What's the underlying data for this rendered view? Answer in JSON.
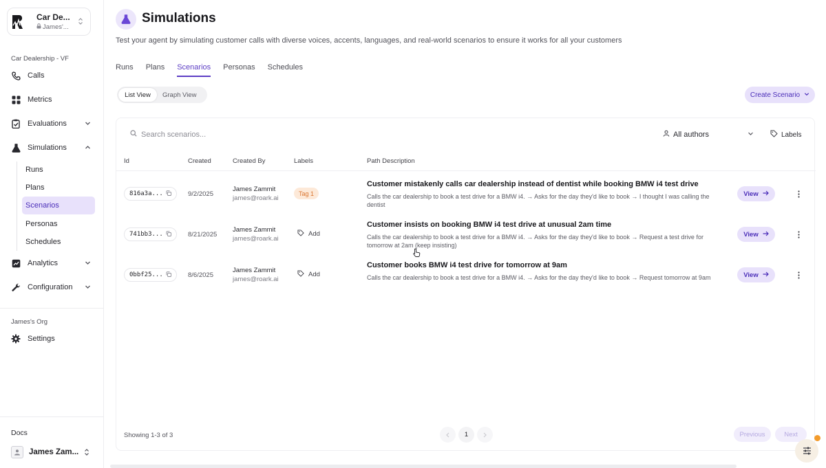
{
  "workspace": {
    "name": "Car De...",
    "owner": "James'..."
  },
  "sidebar": {
    "project_label": "Car Dealership - VF",
    "items": [
      {
        "label": "Calls",
        "icon": "phone-icon"
      },
      {
        "label": "Metrics",
        "icon": "grid-icon"
      },
      {
        "label": "Evaluations",
        "icon": "clipboard-check-icon"
      },
      {
        "label": "Simulations",
        "icon": "flask-icon"
      },
      {
        "label": "Analytics",
        "icon": "chart-icon"
      },
      {
        "label": "Configuration",
        "icon": "wrench-icon"
      }
    ],
    "sub_items": [
      {
        "label": "Runs"
      },
      {
        "label": "Plans"
      },
      {
        "label": "Scenarios"
      },
      {
        "label": "Personas"
      },
      {
        "label": "Schedules"
      }
    ],
    "org_label": "James's Org",
    "settings_label": "Settings",
    "docs_label": "Docs",
    "user_name": "James Zam..."
  },
  "header": {
    "title": "Simulations",
    "description": "Test your agent by simulating customer calls with diverse voices, accents, languages, and real-world scenarios to ensure it works for all your customers"
  },
  "tabs": [
    {
      "label": "Runs"
    },
    {
      "label": "Plans"
    },
    {
      "label": "Scenarios"
    },
    {
      "label": "Personas"
    },
    {
      "label": "Schedules"
    }
  ],
  "view_toggle": {
    "list": "List View",
    "graph": "Graph View"
  },
  "create_button": "Create Scenario",
  "search": {
    "placeholder": "Search scenarios..."
  },
  "authors_filter": "All authors",
  "labels_button": "Labels",
  "table": {
    "headers": {
      "id": "Id",
      "created": "Created",
      "created_by": "Created By",
      "labels": "Labels",
      "path": "Path Description"
    },
    "rows": [
      {
        "id": "816a3a...",
        "created": "9/2/2025",
        "by_name": "James Zammit",
        "by_email": "james@roark.ai",
        "label": "Tag 1",
        "path_title": "Customer mistakenly calls car dealership instead of dentist while booking BMW i4 test drive",
        "path_desc": "Calls the car dealership to book a test drive for a BMW i4. → Asks for the day they'd like to book → I thought I was calling the dentist",
        "view": "View"
      },
      {
        "id": "741bb3...",
        "created": "8/21/2025",
        "by_name": "James Zammit",
        "by_email": "james@roark.ai",
        "label": "Add",
        "path_title": "Customer insists on booking BMW i4 test drive at unusual 2am time",
        "path_desc": "Calls the car dealership to book a test drive for a BMW i4. → Asks for the day they'd like to book → Request a test drive for tomorrow at 2am (keep insisting)",
        "view": "View"
      },
      {
        "id": "0bbf25...",
        "created": "8/6/2025",
        "by_name": "James Zammit",
        "by_email": "james@roark.ai",
        "label": "Add",
        "path_title": "Customer books BMW i4 test drive for tomorrow at 9am",
        "path_desc": "Calls the car dealership to book a test drive for a BMW i4. → Asks for the day they'd like to book → Request tomorrow at 9am",
        "view": "View"
      }
    ]
  },
  "footer": {
    "showing": "Showing 1-3 of 3",
    "page": "1",
    "previous": "Previous",
    "next": "Next"
  },
  "colors": {
    "accent": "#5b3cc4",
    "accent_soft": "#e8e1fb",
    "tag_bg": "#fde9d8",
    "tag_text": "#d9742f"
  }
}
